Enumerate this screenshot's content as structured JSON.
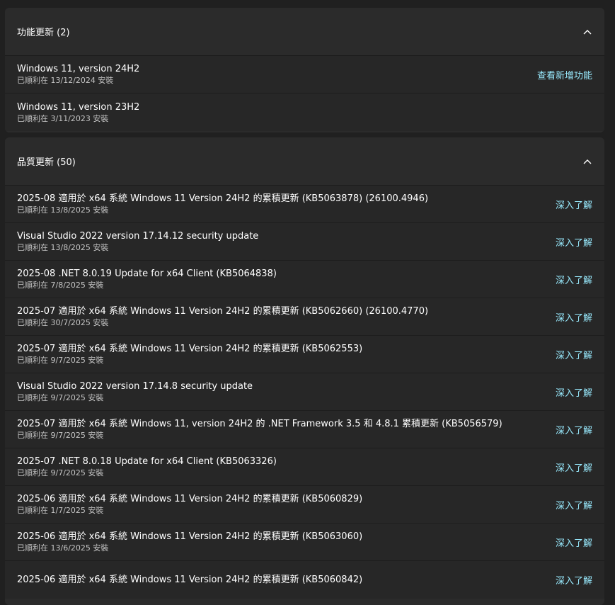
{
  "feature_updates": {
    "title": "功能更新 (2)",
    "items": [
      {
        "title": "Windows 11, version 24H2",
        "status": "已順利在 13/12/2024 安裝",
        "link": "查看新增功能"
      },
      {
        "title": "Windows 11, version 23H2",
        "status": "已順利在 3/11/2023 安裝",
        "link": ""
      }
    ]
  },
  "quality_updates": {
    "title": "品質更新 (50)",
    "items": [
      {
        "title": "2025-08 適用於 x64 系統 Windows 11 Version 24H2 的累積更新 (KB5063878) (26100.4946)",
        "status": "已順利在 13/8/2025 安裝",
        "link": "深入了解"
      },
      {
        "title": "Visual Studio 2022 version 17.14.12 security update",
        "status": "已順利在 13/8/2025 安裝",
        "link": "深入了解"
      },
      {
        "title": "2025-08 .NET 8.0.19 Update for x64 Client (KB5064838)",
        "status": "已順利在 7/8/2025 安裝",
        "link": "深入了解"
      },
      {
        "title": "2025-07 適用於 x64 系統 Windows 11 Version 24H2 的累積更新 (KB5062660) (26100.4770)",
        "status": "已順利在 30/7/2025 安裝",
        "link": "深入了解"
      },
      {
        "title": "2025-07 適用於 x64 系統 Windows 11 Version 24H2 的累積更新 (KB5062553)",
        "status": "已順利在 9/7/2025 安裝",
        "link": "深入了解"
      },
      {
        "title": "Visual Studio 2022 version 17.14.8 security update",
        "status": "已順利在 9/7/2025 安裝",
        "link": "深入了解"
      },
      {
        "title": "2025-07 適用於 x64 系統 Windows 11, version 24H2 的 .NET Framework 3.5 和 4.8.1 累積更新 (KB5056579)",
        "status": "已順利在 9/7/2025 安裝",
        "link": "深入了解"
      },
      {
        "title": "2025-07 .NET 8.0.18 Update for x64 Client (KB5063326)",
        "status": "已順利在 9/7/2025 安裝",
        "link": "深入了解"
      },
      {
        "title": "2025-06 適用於 x64 系統 Windows 11 Version 24H2 的累積更新 (KB5060829)",
        "status": "已順利在 1/7/2025 安裝",
        "link": "深入了解"
      },
      {
        "title": "2025-06 適用於 x64 系統 Windows 11 Version 24H2 的累積更新 (KB5063060)",
        "status": "已順利在 13/6/2025 安裝",
        "link": "深入了解"
      },
      {
        "title": "2025-06 適用於 x64 系統 Windows 11 Version 24H2 的累積更新 (KB5060842)",
        "status": "",
        "link": "深入了解"
      }
    ]
  },
  "icons": {
    "collapse": "chevron-up-icon"
  },
  "colors": {
    "link": "#99ebff",
    "card": "#2b2b2b",
    "row": "#272727",
    "background": "#202020"
  }
}
